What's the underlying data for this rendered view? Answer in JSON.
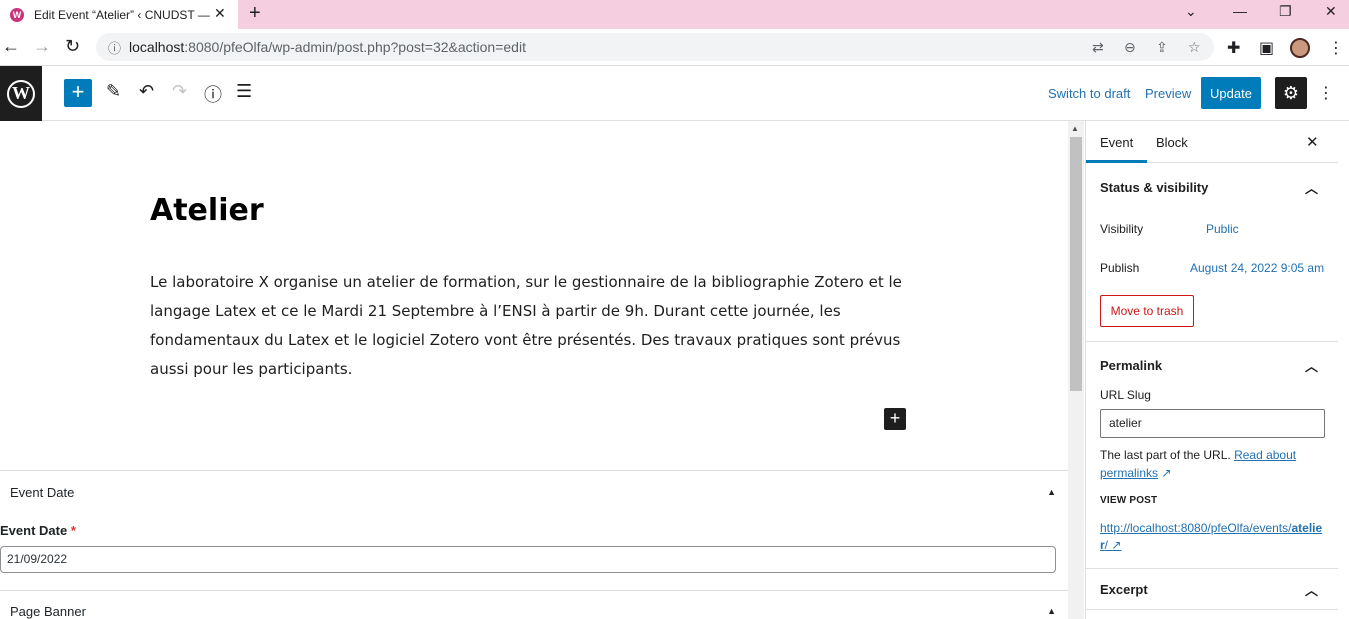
{
  "browser": {
    "tab_title": "Edit Event “Atelier” ‹ CNUDST —",
    "tab_favicon": "W",
    "new_tab": "+",
    "url_host": "localhost",
    "url_rest": ":8080/pfeOlfa/wp-admin/post.php?post=32&action=edit"
  },
  "header": {
    "switch_to_draft": "Switch to draft",
    "preview": "Preview",
    "update": "Update"
  },
  "post": {
    "title": "Atelier",
    "body": "Le laboratoire X organise un atelier de formation, sur le gestionnaire de la bibliographie Zotero et le langage Latex et ce le Mardi 21 Septembre à l’ENSI à partir de 9h. Durant cette journée, les fondamentaux du Latex et le logiciel Zotero vont être présentés. Des travaux pratiques sont prévus aussi pour les participants."
  },
  "meta": {
    "event_date_box": "Event Date",
    "event_date_label": "Event Date",
    "required_mark": "*",
    "event_date_value": "21/09/2022",
    "page_banner_box": "Page Banner"
  },
  "sidebar": {
    "tab_event": "Event",
    "tab_block": "Block",
    "status_title": "Status & visibility",
    "visibility_label": "Visibility",
    "visibility_value": "Public",
    "publish_label": "Publish",
    "publish_value": "August 24, 2022 9:05 am",
    "trash": "Move to trash",
    "permalink_title": "Permalink",
    "slug_label": "URL Slug",
    "slug_value": "atelier",
    "help_text": "The last part of the URL. ",
    "help_link": "Read about permalinks",
    "view_post": "VIEW POST",
    "view_link_prefix": "http://localhost:8080/pfeOlfa/events/",
    "view_link_slug": "atelier",
    "view_link_suffix": "/",
    "excerpt_title": "Excerpt"
  },
  "icons": {
    "accent": "#007cba",
    "danger": "#cc1818",
    "link": "#2271b1"
  }
}
